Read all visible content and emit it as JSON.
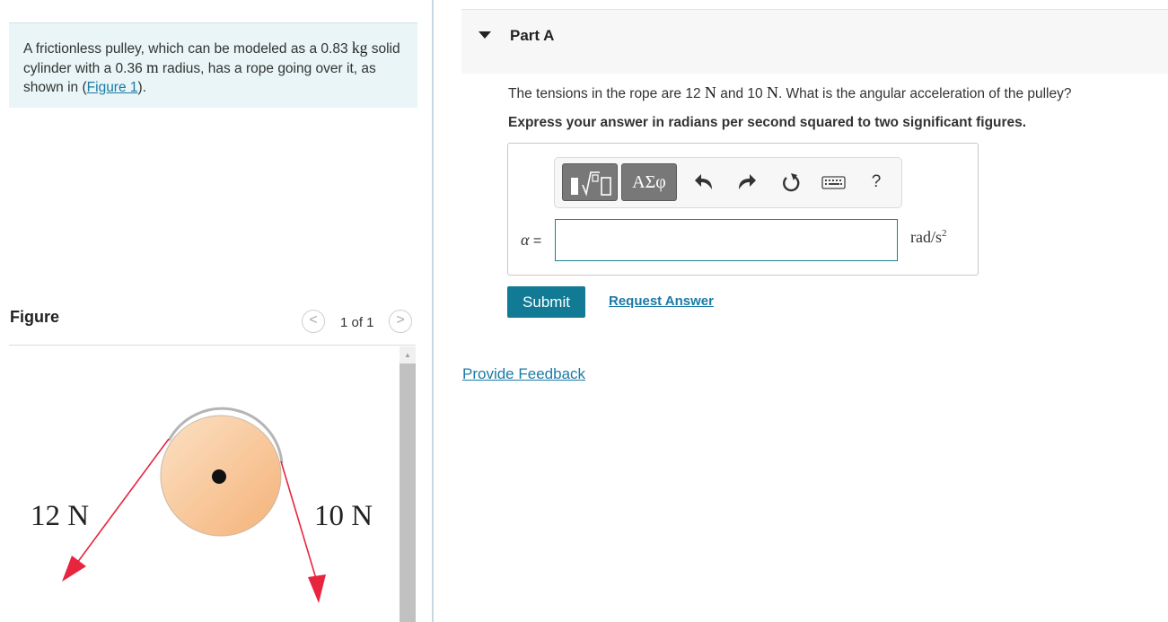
{
  "problem": {
    "text_before_mass": "A frictionless pulley, which can be modeled as a ",
    "mass_value": "0.83",
    "mass_unit": "kg",
    "text_after_mass": " solid cylinder with a ",
    "radius_value": "0.36",
    "radius_unit": "m",
    "text_after_radius": " radius, has a rope going over it, as shown in (",
    "figure_link": "Figure 1",
    "text_end": ")."
  },
  "figure": {
    "title": "Figure",
    "page_counter": "1 of 1",
    "prev_glyph": "<",
    "next_glyph": ">",
    "left_tension_label": "12 N",
    "right_tension_label": "10 N"
  },
  "part": {
    "title": "Part A"
  },
  "question": {
    "text_1": "The tensions in the rope are ",
    "t1_value": "12",
    "t1_unit": "N",
    "text_2": " and ",
    "t2_value": "10",
    "t2_unit": "N",
    "text_3": ". What is the angular acceleration of the pulley?",
    "instruction": "Express your answer in radians per second squared to two significant figures."
  },
  "toolbar": {
    "symbols_label": "ΑΣφ",
    "help_label": "?"
  },
  "answer": {
    "variable_symbol": "α",
    "equals": " =",
    "value": "",
    "unit_base": "rad/s",
    "unit_exponent": "2"
  },
  "buttons": {
    "submit": "Submit",
    "request_answer": "Request Answer",
    "provide_feedback": "Provide Feedback"
  },
  "icons": {
    "toggle": "caret-down-icon",
    "templates": "templates-icon",
    "undo": "undo-icon",
    "redo": "redo-icon",
    "reset": "reset-icon",
    "keyboard": "keyboard-icon",
    "help": "help-icon",
    "scroll_up": "scroll-up-icon"
  },
  "colors": {
    "accent": "#117a95",
    "link": "#1b7aa6",
    "problem_bg": "#e9f5f6",
    "rope": "#e8253f",
    "pulley_fill": "#f6c18d"
  }
}
